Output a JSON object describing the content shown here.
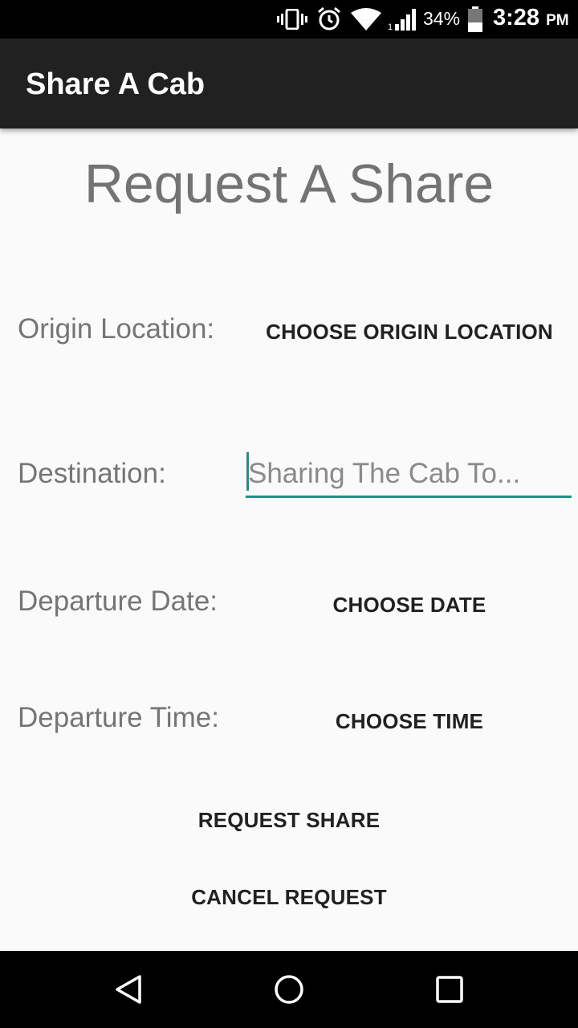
{
  "status_bar": {
    "battery_percent": "34%",
    "time": "3:28",
    "ampm": "PM",
    "icons": [
      "vibrate-icon",
      "alarm-icon",
      "wifi-icon",
      "signal-icon",
      "battery-icon"
    ]
  },
  "app_bar": {
    "title": "Share A Cab"
  },
  "page": {
    "heading": "Request A Share"
  },
  "form": {
    "origin_label": "Origin Location:",
    "origin_button": "CHOOSE ORIGIN LOCATION",
    "destination_label": "Destination:",
    "destination_value": "",
    "destination_placeholder": "Sharing The Cab To...",
    "date_label": "Departure Date:",
    "date_button": "CHOOSE DATE",
    "time_label": "Departure Time:",
    "time_button": "CHOOSE TIME"
  },
  "actions": {
    "request_label": "REQUEST SHARE",
    "cancel_label": "CANCEL REQUEST"
  },
  "nav_bar": {
    "icons": [
      "back-icon",
      "home-icon",
      "recents-icon"
    ]
  },
  "colors": {
    "accent": "#14968a",
    "app_bar": "#212121",
    "background": "#fafafa"
  }
}
